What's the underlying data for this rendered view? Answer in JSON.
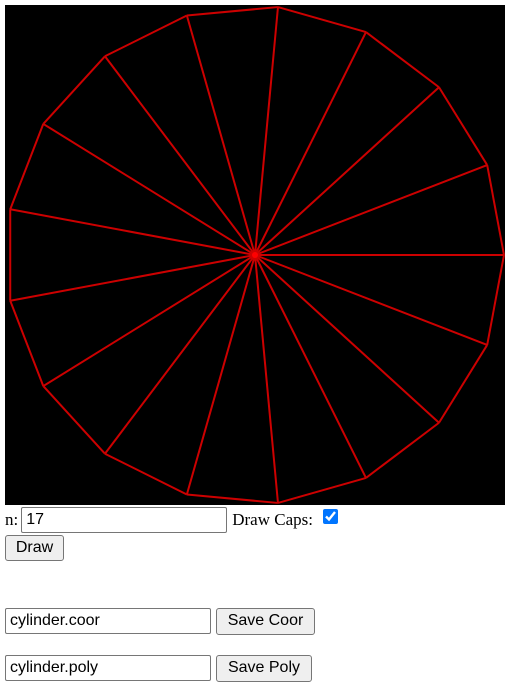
{
  "canvas": {
    "sides": 17,
    "draw_caps": true,
    "background": "#000000",
    "stroke_color": "#cc0000"
  },
  "controls": {
    "n_label": "n:",
    "n_value": "17",
    "draw_caps_label": "Draw Caps:",
    "draw_button": "Draw"
  },
  "export": {
    "coor_filename": "cylinder.coor",
    "save_coor_button": "Save Coor",
    "poly_filename": "cylinder.poly",
    "save_poly_button": "Save Poly"
  }
}
